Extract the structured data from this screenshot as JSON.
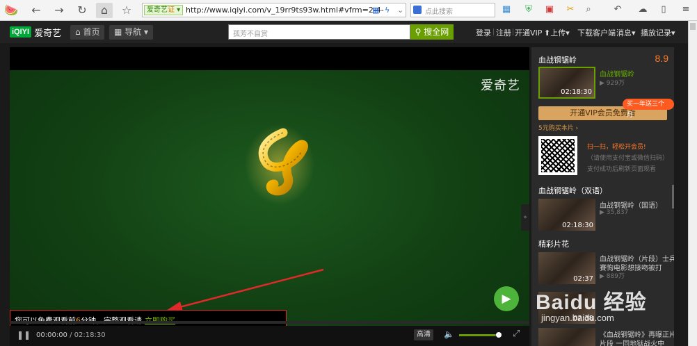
{
  "browser": {
    "cert_label": "爱奇艺",
    "cert_mark": "证",
    "url": "http://www.iqiyi.com/v_19rr9ts93w.html#vfrm=2-4-",
    "search_placeholder": "点此搜索"
  },
  "header": {
    "logo_mark": "iQIYI",
    "logo_text": "爱奇艺",
    "home_label": "首页",
    "nav_label": "导航",
    "search_placeholder": "孤芳不自赏",
    "search_button": "搜全网",
    "links": {
      "login": "登录",
      "register": "注册",
      "vip": "开通VIP",
      "upload": "上传",
      "client": "下载客户端",
      "messages": "消息",
      "history": "播放记录"
    }
  },
  "player": {
    "watermark": "爱奇艺",
    "free_msg_pre": "您可以免费观看前",
    "free_minutes": "6",
    "free_msg_post": "分钟，完整观看请",
    "buy_link": "立即购买",
    "current_time": "00:00:00",
    "total_time": "02:18:30",
    "quality": "高清",
    "volume_level": 0.9
  },
  "sidebar": {
    "title": "血战钢锯岭",
    "score": "8.9",
    "current": {
      "title": "血战钢锯岭",
      "views": "929万",
      "duration": "02:18:30"
    },
    "vip_button": "开通VIP会员免费看",
    "vip_badge": "买一年送三个月",
    "buy_link": "5元购买本片 ›",
    "qr_line1": "扫一扫，轻松开会员!",
    "qr_line2": "（请使用支付宝或微信扫码）",
    "qr_line3": "支付成功后刷新页面观看",
    "bilingual_title": "血战钢锯岭（双语）",
    "bilingual": {
      "title": "血战钢锯岭（国语）",
      "views": "35,837",
      "duration": "02:18:30"
    },
    "highlights_title": "精彩片花",
    "highlights": [
      {
        "title": "血战钢锯岭（片段）士兵",
        "title2": "賽恂电影想接吻被打",
        "views": "889万",
        "duration": "02:37"
      },
      {
        "title": "…",
        "views": "",
        "duration": "02:38"
      },
      {
        "title": "《血战钢锯岭》再曝正片",
        "title2": "片段 一同地狱战火中",
        "views": "",
        "duration": ""
      }
    ]
  },
  "watermark_site": {
    "main": "Baidu 经验",
    "sub": "jingyan.baidu.com"
  }
}
